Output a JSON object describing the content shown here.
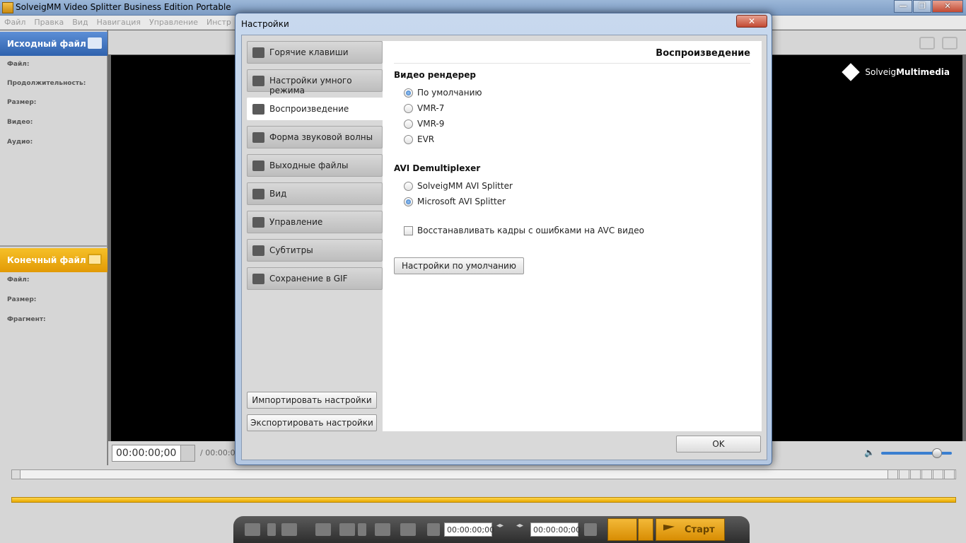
{
  "window": {
    "title": "SolveigMM Video Splitter Business Edition Portable",
    "minimize": "—",
    "maximize": "❐",
    "close": "✕"
  },
  "menu": [
    "Файл",
    "Правка",
    "Вид",
    "Навигация",
    "Управление",
    "Инстр"
  ],
  "source_panel": {
    "title": "Исходный файл",
    "fields": [
      "Файл:",
      "Продолжительность:",
      "Размер:",
      "Видео:",
      "Аудио:"
    ]
  },
  "output_panel": {
    "title": "Конечный файл",
    "fields": [
      "Файл:",
      "Размер:",
      "Фрагмент:"
    ]
  },
  "video": {
    "brand_prefix": "Solveig",
    "brand_bold": "Multimedia",
    "timecode": "00:00:00;00",
    "total_time": "/ 00:00:0",
    "volume_level": 0.78
  },
  "toolbar": {
    "start_time": "00:00:00;00",
    "end_time": "00:00:00;00",
    "start_label": "Старт"
  },
  "dialog": {
    "title": "Настройки",
    "close": "✕",
    "nav": [
      {
        "label": "Горячие клавиши",
        "icon": "keyboard-icon"
      },
      {
        "label": "Настройки умного режима",
        "icon": "film-icon"
      },
      {
        "label": "Воспроизведение",
        "icon": "playback-icon"
      },
      {
        "label": "Форма звуковой волны",
        "icon": "speaker-icon"
      },
      {
        "label": "Выходные файлы",
        "icon": "save-icon"
      },
      {
        "label": "Вид",
        "icon": "view-icon"
      },
      {
        "label": "Управление",
        "icon": "wrench-icon"
      },
      {
        "label": "Субтитры",
        "icon": "subtitles-icon"
      },
      {
        "label": "Сохранение в GIF",
        "icon": "gif-icon"
      }
    ],
    "import_button": "Импортировать настройки",
    "export_button": "Экспортировать настройки",
    "ok_button": "OK",
    "content": {
      "header": "Воспроизведение",
      "renderer_title": "Видео рендерер",
      "renderer_options": [
        "По умолчанию",
        "VMR-7",
        "VMR-9",
        "EVR"
      ],
      "renderer_selected": "По умолчанию",
      "demux_title": "AVI Demultiplexer",
      "demux_options": [
        "SolveigMM AVI Splitter",
        "Microsoft AVI Splitter"
      ],
      "demux_selected": "Microsoft AVI Splitter",
      "checkbox_label": "Восстанавливать кадры с ошибками на AVC видео",
      "checkbox_checked": false,
      "defaults_button": "Настройки по умолчанию"
    }
  }
}
